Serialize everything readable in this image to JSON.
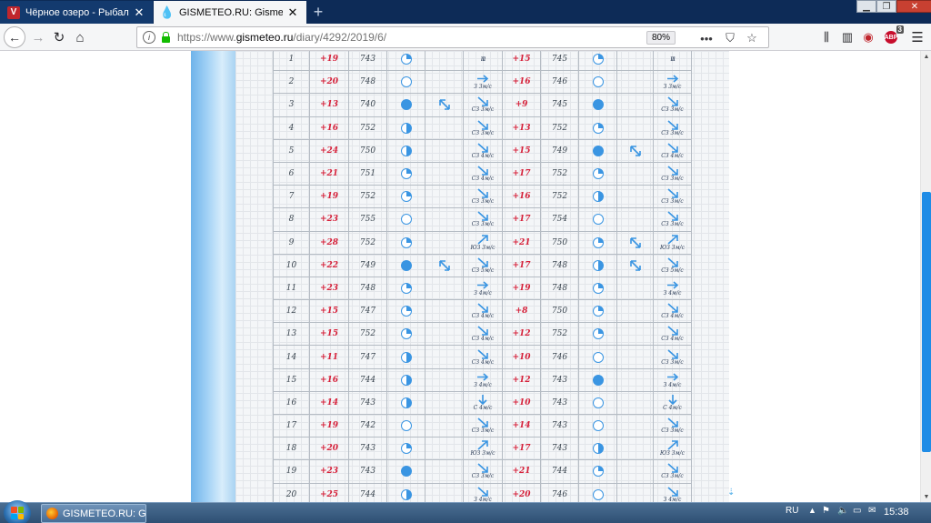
{
  "browser": {
    "tabs": [
      {
        "label": "Чёрное озеро - Рыбалка",
        "favicon": "V"
      },
      {
        "label": "GISMETEO.RU: Gismeteo.Дневник погоды",
        "favicon": "💧"
      }
    ],
    "url_prefix": "https://www.",
    "url_domain": "gismeteo.ru",
    "url_path": "/diary/4292/2019/6/",
    "zoom": "80%",
    "abp_count": "3",
    "abp_label": "ABP"
  },
  "taskbar": {
    "app_label": "GISMETEO.RU: Gism...",
    "lang": "RU",
    "time": "15:38"
  },
  "diary": {
    "rows": [
      {
        "day": "1",
        "t1": "+19",
        "p1": "743",
        "c1": "partly",
        "ph1": "",
        "w1": "calm",
        "wl1": "",
        "t2": "+15",
        "p2": "745",
        "c2": "partly",
        "ph2": "",
        "w2": "calm",
        "wl2": ""
      },
      {
        "day": "2",
        "t1": "+20",
        "p1": "748",
        "c1": "clear",
        "ph1": "",
        "w1": "e",
        "wl1": "З 3м/с",
        "t2": "+16",
        "p2": "746",
        "c2": "clear",
        "ph2": "",
        "w2": "e",
        "wl2": "З 3м/с"
      },
      {
        "day": "3",
        "t1": "+13",
        "p1": "740",
        "c1": "full",
        "ph1": "rain",
        "w1": "se",
        "wl1": "СЗ 3м/с",
        "t2": "+9",
        "p2": "745",
        "c2": "full",
        "ph2": "",
        "w2": "se",
        "wl2": "СЗ 3м/с"
      },
      {
        "day": "4",
        "t1": "+16",
        "p1": "752",
        "c1": "half",
        "ph1": "",
        "w1": "se",
        "wl1": "СЗ 3м/с",
        "t2": "+13",
        "p2": "752",
        "c2": "partly",
        "ph2": "",
        "w2": "se",
        "wl2": "СЗ 3м/с"
      },
      {
        "day": "5",
        "t1": "+24",
        "p1": "750",
        "c1": "half",
        "ph1": "",
        "w1": "se",
        "wl1": "СЗ 4м/с",
        "t2": "+15",
        "p2": "749",
        "c2": "full",
        "ph2": "rain",
        "w2": "se",
        "wl2": "СЗ 4м/с"
      },
      {
        "day": "6",
        "t1": "+21",
        "p1": "751",
        "c1": "partly",
        "ph1": "",
        "w1": "se",
        "wl1": "СЗ 4м/с",
        "t2": "+17",
        "p2": "752",
        "c2": "partly",
        "ph2": "",
        "w2": "se",
        "wl2": "СЗ 3м/с"
      },
      {
        "day": "7",
        "t1": "+19",
        "p1": "752",
        "c1": "partly",
        "ph1": "",
        "w1": "se",
        "wl1": "СЗ 3м/с",
        "t2": "+16",
        "p2": "752",
        "c2": "half",
        "ph2": "",
        "w2": "se",
        "wl2": "СЗ 3м/с"
      },
      {
        "day": "8",
        "t1": "+23",
        "p1": "755",
        "c1": "clear",
        "ph1": "",
        "w1": "se",
        "wl1": "СЗ 3м/с",
        "t2": "+17",
        "p2": "754",
        "c2": "clear",
        "ph2": "",
        "w2": "se",
        "wl2": "СЗ 3м/с"
      },
      {
        "day": "9",
        "t1": "+28",
        "p1": "752",
        "c1": "partly",
        "ph1": "",
        "w1": "ne",
        "wl1": "ЮЗ 3м/с",
        "t2": "+21",
        "p2": "750",
        "c2": "partly",
        "ph2": "rain",
        "w2": "ne",
        "wl2": "ЮЗ 3м/с"
      },
      {
        "day": "10",
        "t1": "+22",
        "p1": "749",
        "c1": "full",
        "ph1": "rain",
        "w1": "se",
        "wl1": "СЗ 5м/с",
        "t2": "+17",
        "p2": "748",
        "c2": "half",
        "ph2": "rain",
        "w2": "se",
        "wl2": "СЗ 5м/с"
      },
      {
        "day": "11",
        "t1": "+23",
        "p1": "748",
        "c1": "partly",
        "ph1": "",
        "w1": "e",
        "wl1": "З 4м/с",
        "t2": "+19",
        "p2": "748",
        "c2": "partly",
        "ph2": "",
        "w2": "e",
        "wl2": "З 4м/с"
      },
      {
        "day": "12",
        "t1": "+15",
        "p1": "747",
        "c1": "partly",
        "ph1": "",
        "w1": "se",
        "wl1": "СЗ 4м/с",
        "t2": "+8",
        "p2": "750",
        "c2": "partly",
        "ph2": "",
        "w2": "se",
        "wl2": "СЗ 4м/с"
      },
      {
        "day": "13",
        "t1": "+15",
        "p1": "752",
        "c1": "partly",
        "ph1": "",
        "w1": "se",
        "wl1": "СЗ 4м/с",
        "t2": "+12",
        "p2": "752",
        "c2": "partly",
        "ph2": "",
        "w2": "se",
        "wl2": "СЗ 4м/с"
      },
      {
        "day": "14",
        "t1": "+11",
        "p1": "747",
        "c1": "half",
        "ph1": "",
        "w1": "se",
        "wl1": "СЗ 4м/с",
        "t2": "+10",
        "p2": "746",
        "c2": "clear",
        "ph2": "",
        "w2": "se",
        "wl2": "СЗ 3м/с"
      },
      {
        "day": "15",
        "t1": "+16",
        "p1": "744",
        "c1": "half",
        "ph1": "",
        "w1": "e",
        "wl1": "З 4м/с",
        "t2": "+12",
        "p2": "743",
        "c2": "full",
        "ph2": "",
        "w2": "e",
        "wl2": "З 4м/с"
      },
      {
        "day": "16",
        "t1": "+14",
        "p1": "743",
        "c1": "half",
        "ph1": "",
        "w1": "s",
        "wl1": "С 4м/с",
        "t2": "+10",
        "p2": "743",
        "c2": "clear",
        "ph2": "",
        "w2": "s",
        "wl2": "С 4м/с"
      },
      {
        "day": "17",
        "t1": "+19",
        "p1": "742",
        "c1": "clear",
        "ph1": "",
        "w1": "se",
        "wl1": "СЗ 3м/с",
        "t2": "+14",
        "p2": "743",
        "c2": "clear",
        "ph2": "",
        "w2": "se",
        "wl2": "СЗ 3м/с"
      },
      {
        "day": "18",
        "t1": "+20",
        "p1": "743",
        "c1": "partly",
        "ph1": "",
        "w1": "ne",
        "wl1": "ЮЗ 3м/с",
        "t2": "+17",
        "p2": "743",
        "c2": "half",
        "ph2": "",
        "w2": "ne",
        "wl2": "ЮЗ 3м/с"
      },
      {
        "day": "19",
        "t1": "+23",
        "p1": "743",
        "c1": "full",
        "ph1": "",
        "w1": "se",
        "wl1": "СЗ 3м/с",
        "t2": "+21",
        "p2": "744",
        "c2": "partly",
        "ph2": "",
        "w2": "se",
        "wl2": "СЗ 3м/с"
      },
      {
        "day": "20",
        "t1": "+25",
        "p1": "744",
        "c1": "half",
        "ph1": "",
        "w1": "se",
        "wl1": "З 4м/с",
        "t2": "+20",
        "p2": "746",
        "c2": "clear",
        "ph2": "",
        "w2": "se",
        "wl2": "З 4м/с"
      }
    ]
  },
  "colors": {
    "accent": "#3a95e2",
    "temperature": "#d6213a",
    "scroll_thumb": "#1f8ce6"
  }
}
